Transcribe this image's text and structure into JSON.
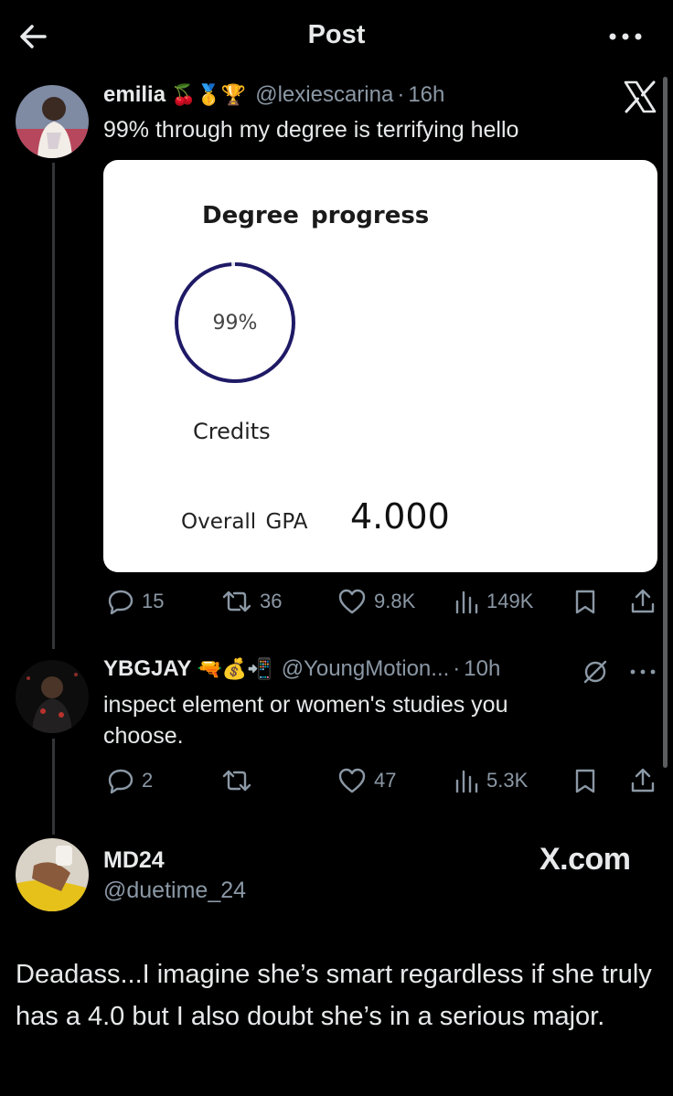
{
  "header": {
    "title": "Post"
  },
  "tweet1": {
    "name": "emilia",
    "emojis": "🍒🥇🏆",
    "handle": "@lexiescarina",
    "separator": "·",
    "time": "16h",
    "text": "99% through my degree is terrifying hello",
    "card": {
      "title": "Degree progress",
      "progress_label": "99%",
      "progress_fraction": 0.99,
      "credits_label": "Credits",
      "gpa_label": "Overall GPA",
      "gpa_value": "4.000"
    },
    "actions": {
      "replies": "15",
      "reposts": "36",
      "likes": "9.8K",
      "views": "149K"
    }
  },
  "reply1": {
    "name": "YBGJAY",
    "emojis": "🔫💰📲",
    "handle": "@YoungMotion...",
    "separator": "·",
    "time": "10h",
    "text": "inspect element or women's studies you choose.",
    "actions": {
      "replies": "2",
      "reposts": "",
      "likes": "47",
      "views": "5.3K"
    }
  },
  "quote": {
    "name": "MD24",
    "handle": "@duetime_24",
    "brand": "X.com",
    "text": "Deadass...I imagine she’s smart regardless if she truly has a 4.0 but I also doubt she’s in a serious major."
  },
  "colors": {
    "background": "#000000",
    "text_primary": "#e7e9ea",
    "text_secondary": "#8b98a5",
    "ring": "#1f1a66"
  }
}
